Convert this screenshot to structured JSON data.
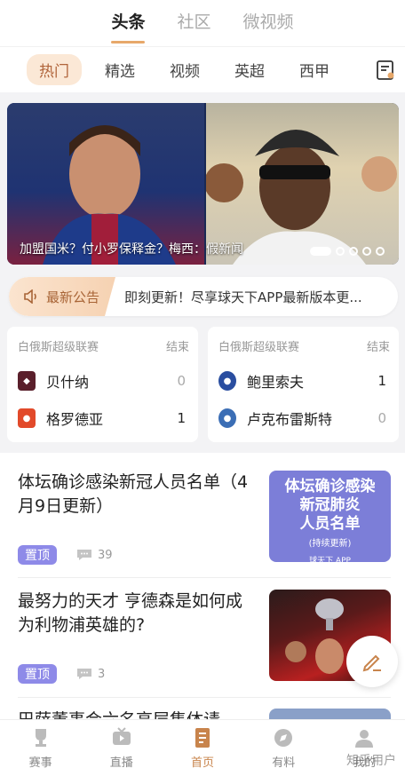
{
  "top_tabs": [
    {
      "label": "头条",
      "active": true
    },
    {
      "label": "社区",
      "active": false
    },
    {
      "label": "微视频",
      "active": false
    }
  ],
  "sub_tabs": [
    {
      "label": "热门",
      "active": true
    },
    {
      "label": "精选"
    },
    {
      "label": "视频"
    },
    {
      "label": "英超"
    },
    {
      "label": "西甲"
    }
  ],
  "banner": {
    "caption": "加盟国米？付小罗保释金？梅西：假新闻",
    "slide_count": 5,
    "active_slide": 1
  },
  "announcement": {
    "label": "最新公告",
    "text": "即刻更新！尽享球天下APP最新版本更..."
  },
  "matches": [
    {
      "league": "白俄斯超级联赛",
      "status": "结束",
      "home": {
        "name": "贝什纳",
        "score": "0"
      },
      "away": {
        "name": "格罗德亚",
        "score": "1"
      }
    },
    {
      "league": "白俄斯超级联赛",
      "status": "结束",
      "home": {
        "name": "鲍里索夫",
        "score": "1"
      },
      "away": {
        "name": "卢克布雷斯特",
        "score": "0"
      }
    }
  ],
  "news": [
    {
      "title": "体坛确诊感染新冠人员名单（4月9日更新）",
      "tag": "置顶",
      "comments": "39",
      "thumb_lines": [
        "体坛确诊感染",
        "新冠肺炎",
        "人员名单"
      ],
      "thumb_sub": "(持续更新)",
      "thumb_brand": "球天下 APP"
    },
    {
      "title": "最努力的天才 亨德森是如何成为利物浦英雄的?",
      "tag": "置顶",
      "comments": "3"
    },
    {
      "title": "巴萨董事会六名高层集体请"
    }
  ],
  "bottom_nav": [
    {
      "label": "赛事"
    },
    {
      "label": "直播"
    },
    {
      "label": "首页",
      "active": true
    },
    {
      "label": "有料"
    },
    {
      "label": "我的"
    }
  ],
  "watermark": "知乎用户",
  "colors": {
    "accent": "#c8844c",
    "tag": "#8e8ae8"
  }
}
